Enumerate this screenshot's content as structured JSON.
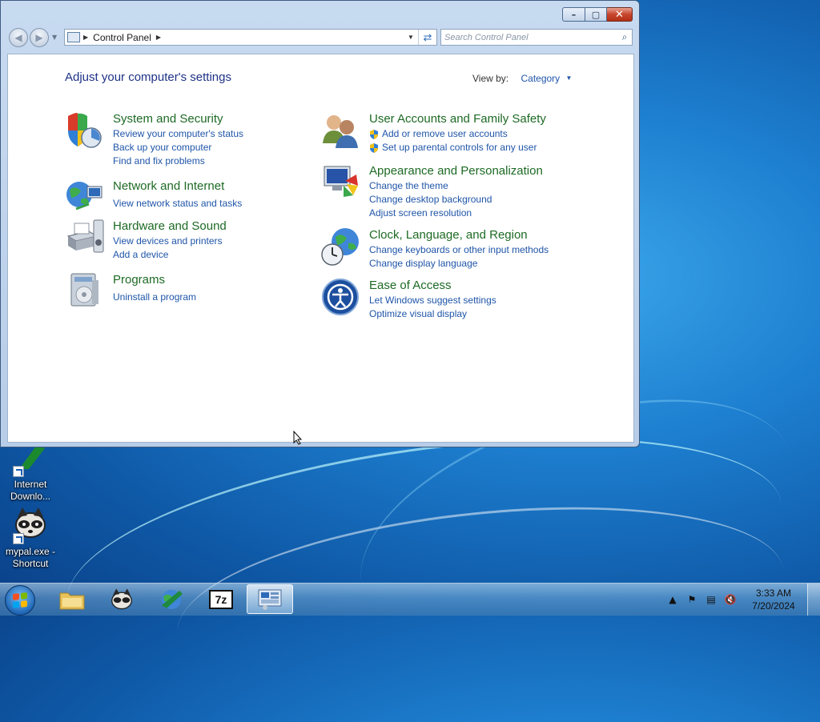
{
  "window": {
    "address": {
      "crumbs": [
        "Control Panel"
      ]
    },
    "search": {
      "placeholder": "Search Control Panel"
    },
    "heading": "Adjust your computer's settings",
    "view_by": {
      "label": "View by:",
      "value": "Category"
    },
    "categories_left": [
      {
        "title": "System and Security",
        "icon": "shield-security-icon",
        "links": [
          "Review your computer's status",
          "Back up your computer",
          "Find and fix problems"
        ]
      },
      {
        "title": "Network and Internet",
        "icon": "network-globe-icon",
        "links": [
          "View network status and tasks"
        ]
      },
      {
        "title": "Hardware and Sound",
        "icon": "printer-speaker-icon",
        "links": [
          "View devices and printers",
          "Add a device"
        ]
      },
      {
        "title": "Programs",
        "icon": "programs-icon",
        "links": [
          "Uninstall a program"
        ]
      }
    ],
    "categories_right": [
      {
        "title": "User Accounts and Family Safety",
        "icon": "users-icon",
        "links": [
          "Add or remove user accounts",
          "Set up parental controls for any user"
        ]
      },
      {
        "title": "Appearance and Personalization",
        "icon": "monitor-colors-icon",
        "links": [
          "Change the theme",
          "Change desktop background",
          "Adjust screen resolution"
        ]
      },
      {
        "title": "Clock, Language, and Region",
        "icon": "clock-globe-icon",
        "links": [
          "Change keyboards or other input methods",
          "Change display language"
        ]
      },
      {
        "title": "Ease of Access",
        "icon": "ease-of-access-icon",
        "links": [
          "Let Windows suggest settings",
          "Optimize visual display"
        ]
      }
    ]
  },
  "desktop": {
    "icons": [
      {
        "label": "Internet Downlo...",
        "icon": "internet-download-manager-icon"
      },
      {
        "label": "mypal.exe - Shortcut",
        "icon": "raccoon-icon"
      }
    ]
  },
  "taskbar": {
    "pinned": [
      "file-explorer-icon",
      "mypal-raccoon-icon",
      "internet-download-manager-icon",
      "7zip-icon",
      "control-panel-icon"
    ],
    "pinned_text": {
      "sevenzip": "7z"
    },
    "clock": {
      "time": "3:33 AM",
      "date": "7/20/2024"
    }
  },
  "colors": {
    "link": "#1f55a8",
    "category_title": "#1d6a24",
    "heading": "#1e3287"
  }
}
